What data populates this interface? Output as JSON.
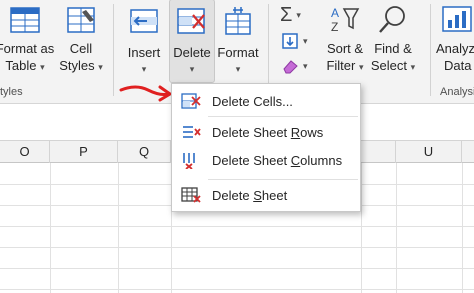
{
  "ribbon": {
    "format_as_table": {
      "line1": "Format as",
      "line2": "Table"
    },
    "cell_styles": {
      "line1": "Cell",
      "line2": "Styles"
    },
    "styles_group_label": "tyles",
    "insert_label": "Insert",
    "delete_label": "Delete",
    "format_label": "Format",
    "sort_filter": {
      "line1": "Sort &",
      "line2": "Filter"
    },
    "find_select": {
      "line1": "Find &",
      "line2": "Select"
    },
    "analyze": {
      "line1": "Analyz",
      "line2": "Data"
    },
    "analysis_group_label": "Analysis"
  },
  "delete_menu": {
    "items": [
      {
        "label_pre": "Delete Cells...",
        "ul": "",
        "label_post": ""
      },
      {
        "label_pre": "Delete Sheet ",
        "ul": "R",
        "label_post": "ows"
      },
      {
        "label_pre": "Delete Sheet ",
        "ul": "C",
        "label_post": "olumns"
      },
      {
        "label_pre": "Delete ",
        "ul": "S",
        "label_post": "heet"
      }
    ]
  },
  "columns": [
    "O",
    "P",
    "Q",
    "U"
  ],
  "colors": {
    "accent_blue": "#2b6cc4",
    "delete_red": "#d32f2f",
    "annotation_arrow": "#e02020"
  }
}
